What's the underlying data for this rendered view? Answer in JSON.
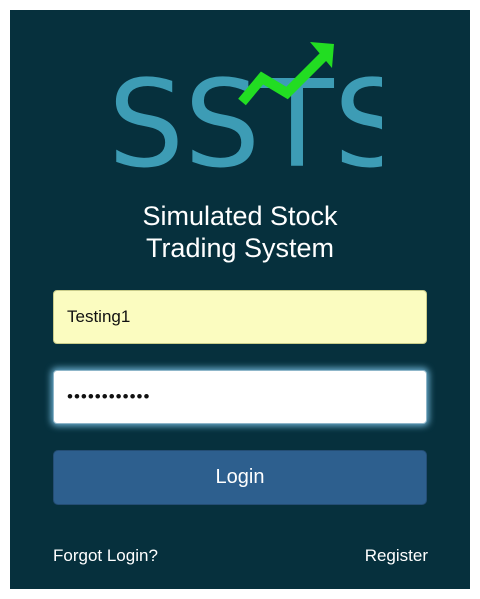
{
  "brand": {
    "logo_text": "SSTS",
    "tagline_line1": "Simulated Stock",
    "tagline_line2": "Trading System"
  },
  "form": {
    "username_value": "Testing1",
    "password_value": "••••••••••••",
    "login_label": "Login"
  },
  "links": {
    "forgot_label": "Forgot Login?",
    "register_label": "Register"
  },
  "colors": {
    "panel_bg": "#06303d",
    "logo_teal": "#3d9cb5",
    "arrow_green": "#22dd22",
    "username_bg": "#fbfcc0",
    "button_bg": "#2d5f8e"
  }
}
